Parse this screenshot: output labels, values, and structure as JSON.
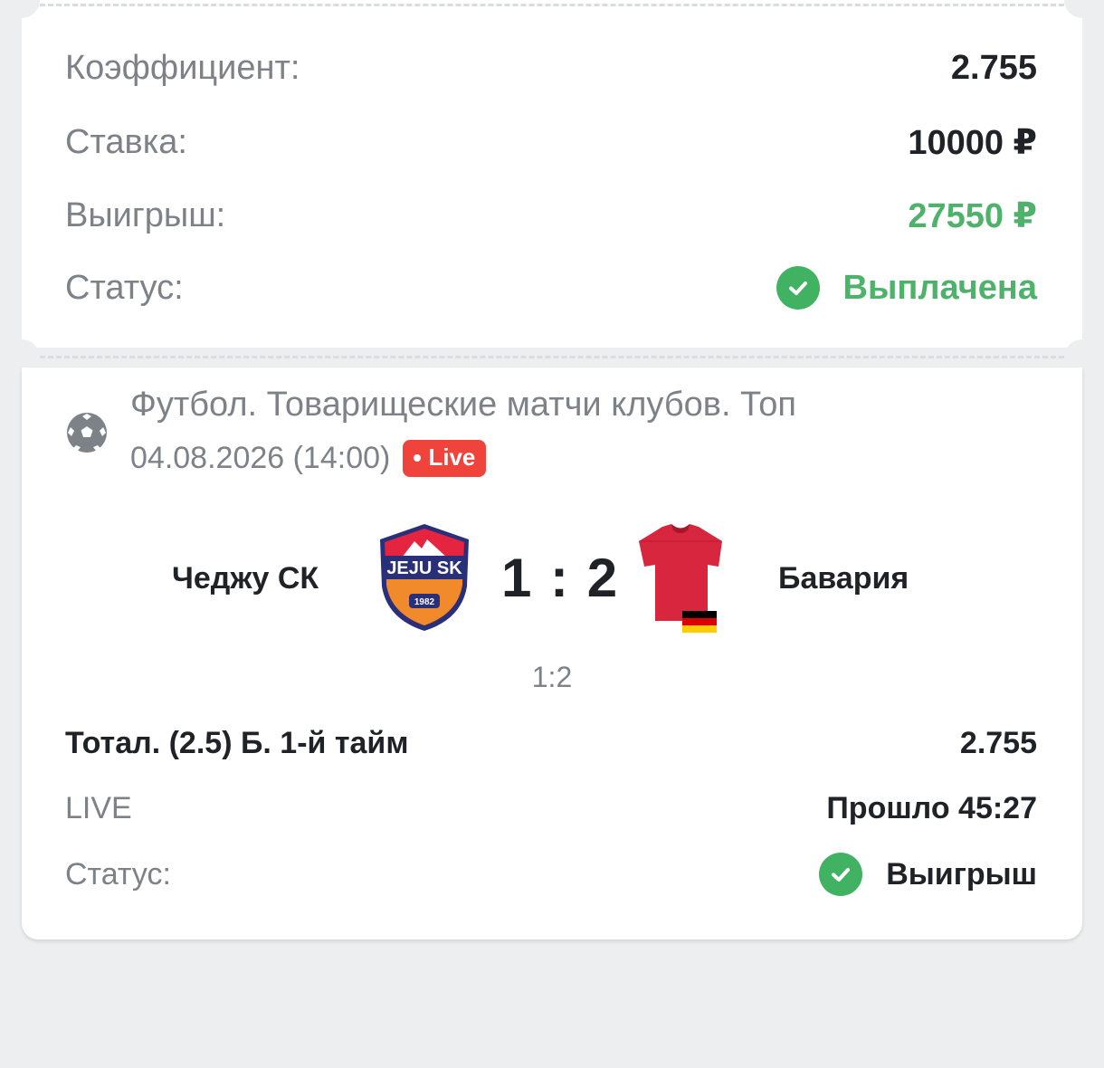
{
  "summary": {
    "coefficient_label": "Коэффициент:",
    "coefficient_value": "2.755",
    "stake_label": "Ставка:",
    "stake_value": "10000 ₽",
    "win_label": "Выигрыш:",
    "win_value": "27550 ₽",
    "status_label": "Статус:",
    "status_value": "Выплачена"
  },
  "event": {
    "sport_icon": "soccer-ball-icon",
    "league": "Футбол. Товарищеские матчи клубов. Топ",
    "datetime": "04.08.2026 (14:00)",
    "live_badge": "Live",
    "home_team": "Чеджу СК",
    "home_logo_text": "JEJU SK",
    "home_logo_year": "1982",
    "away_team": "Бавария",
    "score": "1 : 2",
    "half_score": "1:2"
  },
  "bet": {
    "market": "Тотал. (2.5) Б. 1-й тайм",
    "odds": "2.755",
    "mode_label": "LIVE",
    "elapsed": "Прошло 45:27",
    "status_label": "Статус:",
    "status_value": "Выигрыш"
  },
  "colors": {
    "accent_green": "#41b262",
    "live_red": "#f0433c",
    "background": "#eceef0"
  }
}
